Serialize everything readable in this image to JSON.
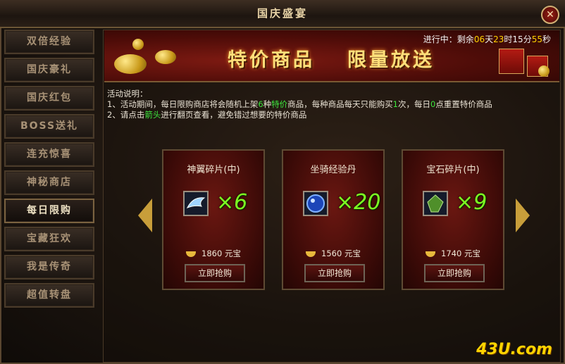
{
  "window": {
    "title": "国庆盛宴",
    "close_label": "✕"
  },
  "sidebar": {
    "items": [
      {
        "label": "双倍经验"
      },
      {
        "label": "国庆豪礼"
      },
      {
        "label": "国庆红包"
      },
      {
        "label": "BOSS送礼"
      },
      {
        "label": "连充惊喜"
      },
      {
        "label": "神秘商店"
      },
      {
        "label": "每日限购"
      },
      {
        "label": "宝藏狂欢"
      },
      {
        "label": "我是传奇"
      },
      {
        "label": "超值转盘"
      }
    ]
  },
  "banner": {
    "left_text": "特价商品",
    "right_text": "限量放送"
  },
  "countdown": {
    "prefix": "进行中：剩余",
    "days": "06",
    "days_unit": "天",
    "hours": "23",
    "hours_unit": "时",
    "minutes": "15",
    "minutes_unit": "分",
    "seconds": "55",
    "seconds_unit": "秒"
  },
  "description": {
    "title": "活动说明：",
    "line1_a": "1、活动期间，每日限购商店将会随机上架",
    "line1_b": "6",
    "line1_c": "种",
    "line1_d": "特价",
    "line1_e": "商品，每种商品每天只能购买",
    "line1_f": "1",
    "line1_g": "次，每日",
    "line1_h": "0",
    "line1_i": "点重置特价商品",
    "line2_a": "2、请点击",
    "line2_b": "箭头",
    "line2_c": "进行翻页查看，避免错过想要的特价商品"
  },
  "products": [
    {
      "name": "神翼碎片(中)",
      "qty": "×6",
      "price": "1860",
      "currency": "元宝",
      "buy_label": "立即抢购",
      "icon": "wing-fragment-icon"
    },
    {
      "name": "坐骑经验丹",
      "qty": "×20",
      "price": "1560",
      "currency": "元宝",
      "buy_label": "立即抢购",
      "icon": "mount-exp-pill-icon"
    },
    {
      "name": "宝石碎片(中)",
      "qty": "×9",
      "price": "1740",
      "currency": "元宝",
      "buy_label": "立即抢购",
      "icon": "gem-fragment-icon"
    }
  ],
  "watermark": "43U.com",
  "colors": {
    "accent_gold": "#ffd200",
    "highlight_green": "#3ee63e",
    "qty_green": "#7dff22"
  }
}
